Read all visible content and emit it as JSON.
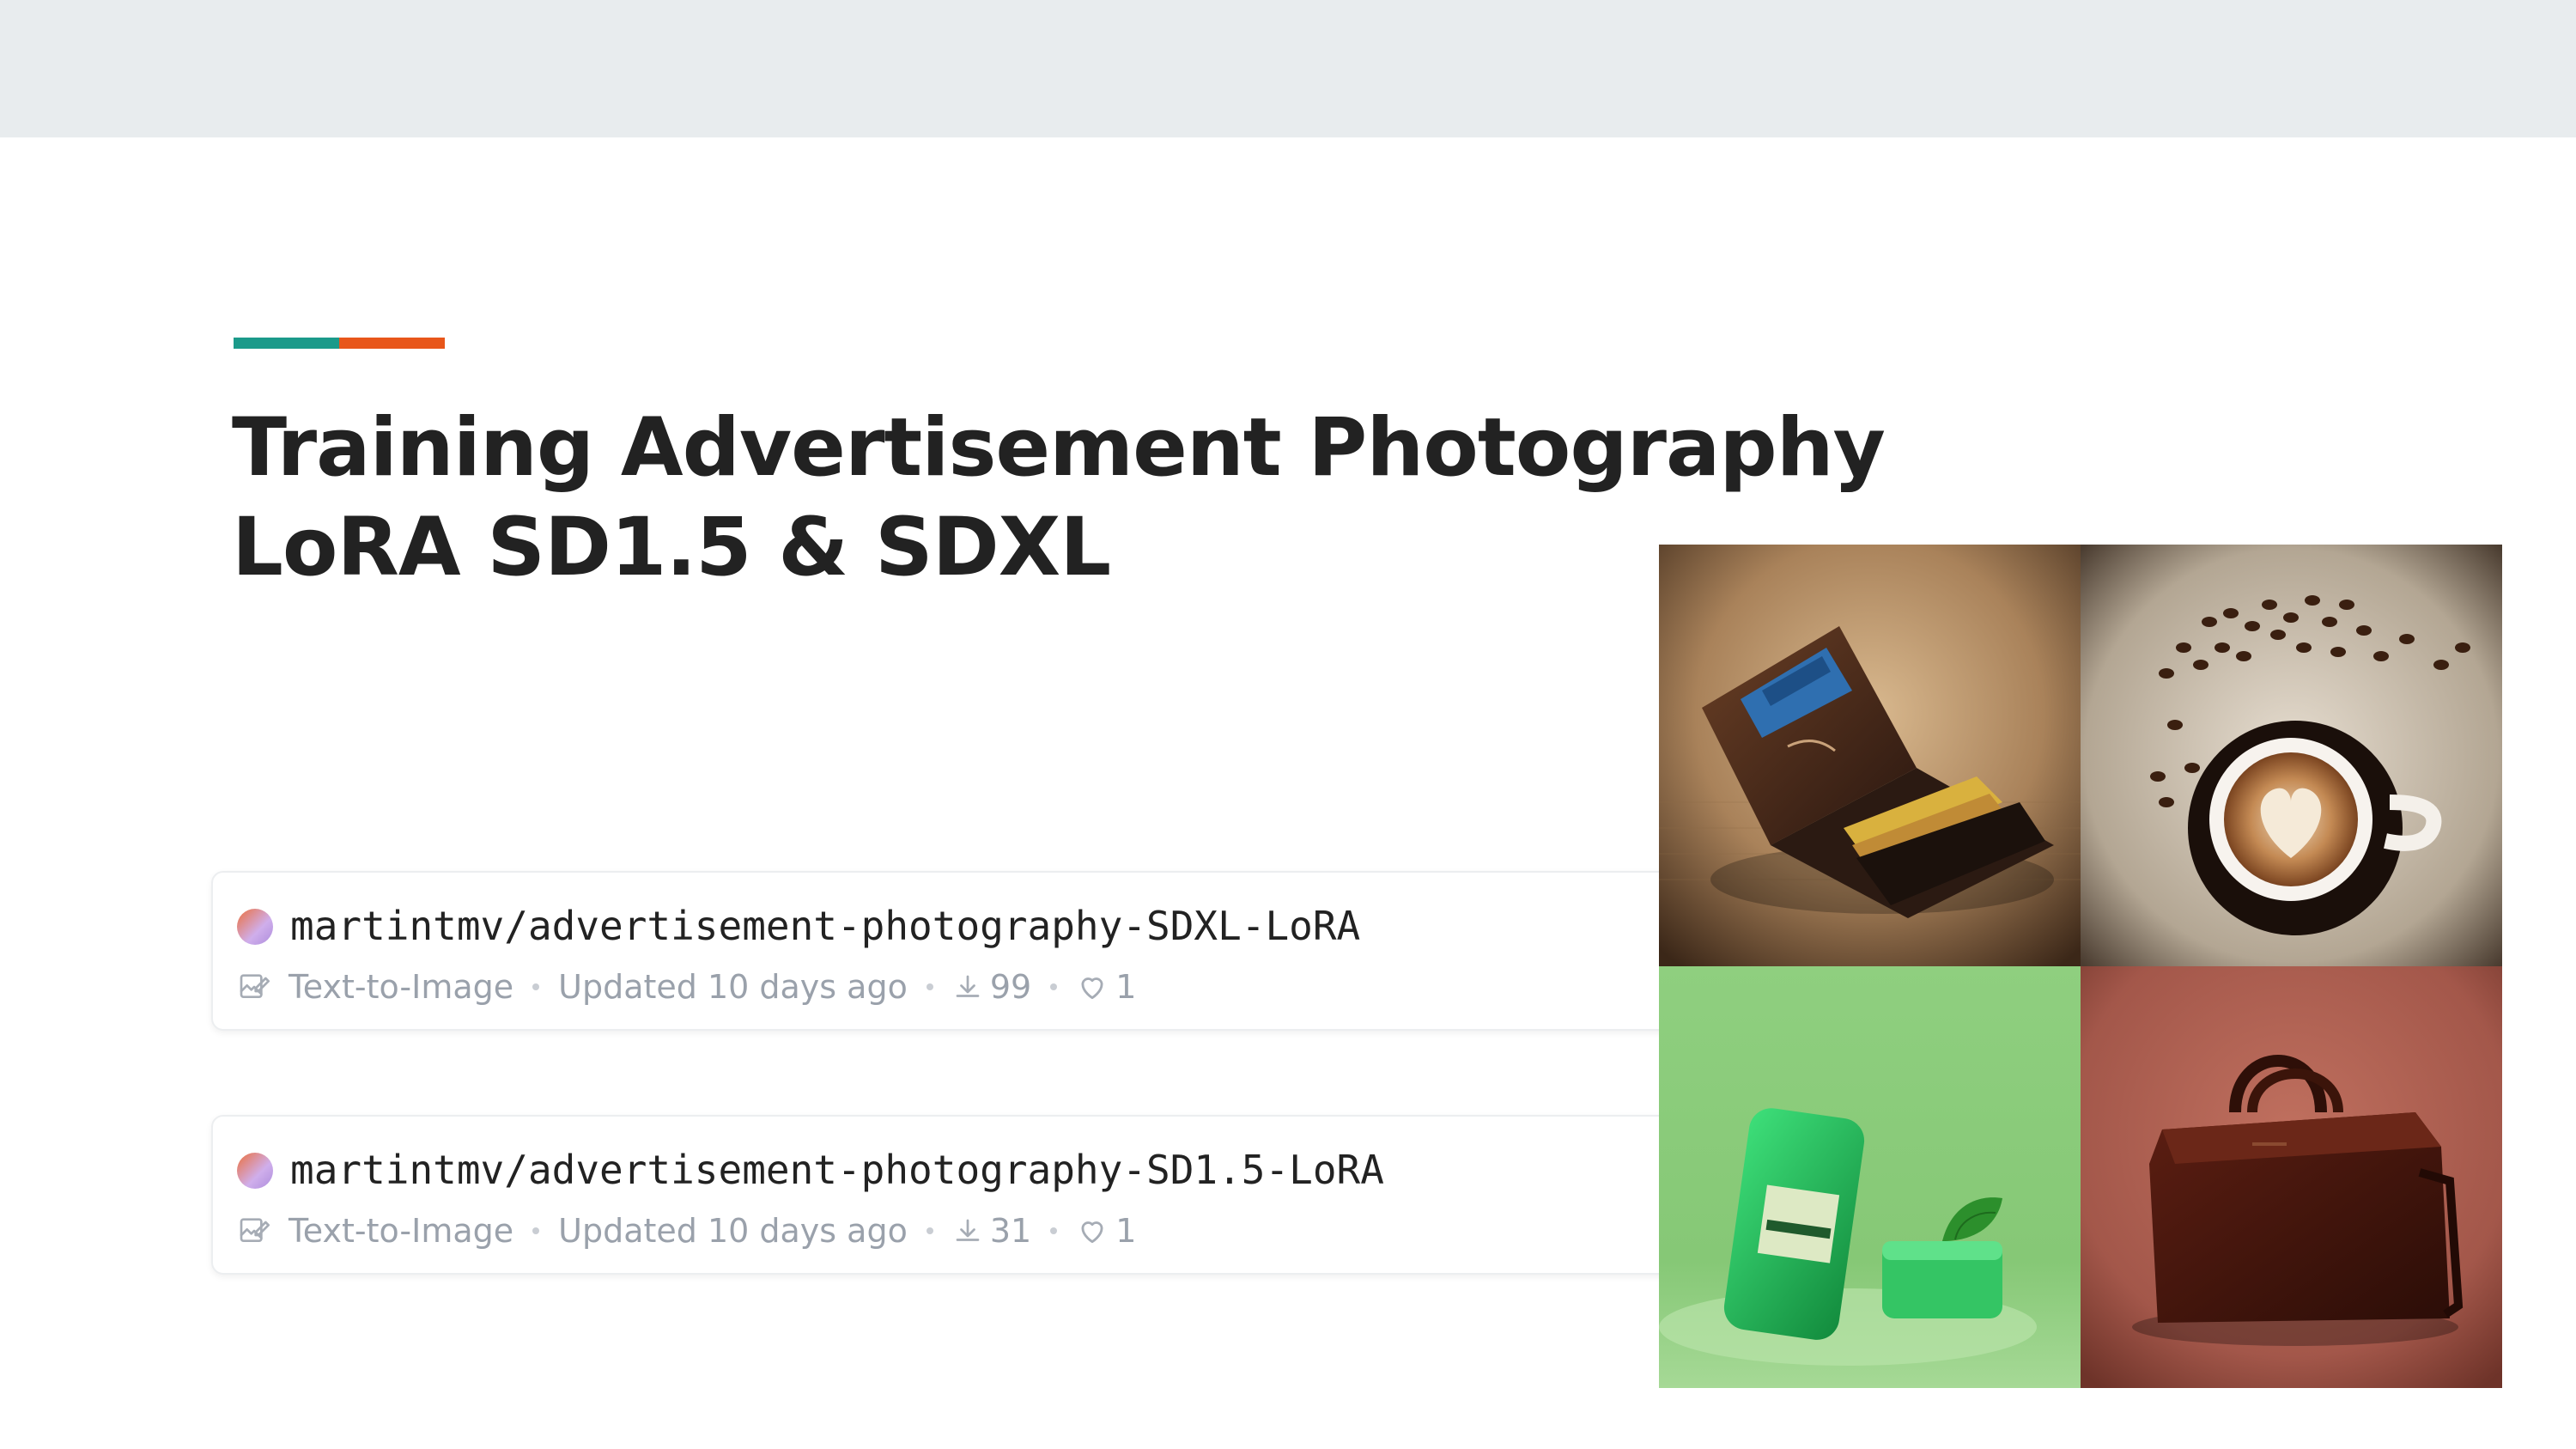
{
  "slide": {
    "title_line1": "Training Advertisement Photography",
    "title_line2": "LoRA SD1.5 & SDXL"
  },
  "colors": {
    "top_band": "#e8ecee",
    "accent_teal": "#1b9a8a",
    "accent_orange": "#e8561a",
    "title_text": "#222222",
    "meta_text": "#9aa1ab"
  },
  "models": [
    {
      "name": "martintmv/advertisement-photography-SDXL-LoRA",
      "task": "Text-to-Image",
      "updated": "Updated 10 days ago",
      "downloads": "99",
      "likes": "1",
      "task_icon": "text-to-image-icon",
      "download_icon": "download-icon",
      "like_icon": "heart-icon"
    },
    {
      "name": "martintmv/advertisement-photography-SD1.5-LoRA",
      "task": "Text-to-Image",
      "updated": "Updated 10 days ago",
      "downloads": "31",
      "likes": "1",
      "task_icon": "text-to-image-icon",
      "download_icon": "download-icon",
      "like_icon": "heart-icon"
    }
  ],
  "images": [
    {
      "subject": "wallet-image"
    },
    {
      "subject": "coffee-image"
    },
    {
      "subject": "soap-image"
    },
    {
      "subject": "handbag-image"
    }
  ]
}
